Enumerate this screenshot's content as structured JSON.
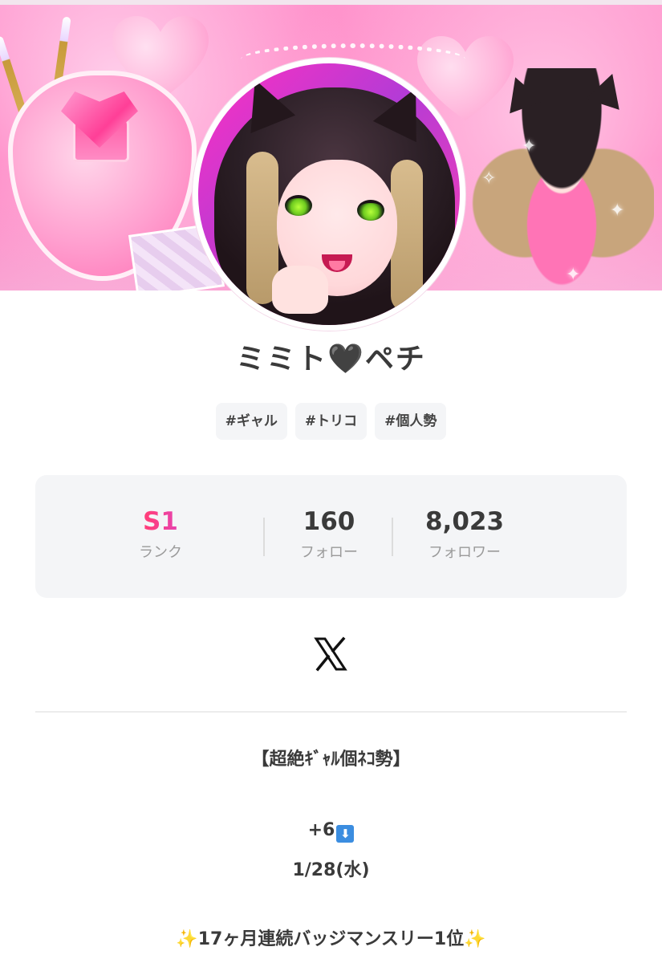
{
  "profile": {
    "name": "ミミト🖤ペチ",
    "tags": [
      "#ギャル",
      "#トリコ",
      "#個人勢"
    ]
  },
  "stats": [
    {
      "value": "S1",
      "label": "ランク"
    },
    {
      "value": "160",
      "label": "フォロー"
    },
    {
      "value": "8,023",
      "label": "フォロワー"
    }
  ],
  "social": {
    "x_icon": "x-logo-icon"
  },
  "bio": {
    "line1": "【超絶ｷﾞｬﾙ個ﾈｺ勢】",
    "line2_prefix": "+6",
    "line2_icon": "down-arrow-box-icon",
    "line3": "1/28(水)",
    "line4_text": "17ヶ月連続バッジマンスリー1位",
    "line4_icon": "sparkles-icon"
  },
  "colors": {
    "rank_gradient_start": "#ff2d6f",
    "rank_gradient_end": "#c04cff",
    "card_bg": "#f4f5f7",
    "banner_pink": "#ff6fb8"
  }
}
